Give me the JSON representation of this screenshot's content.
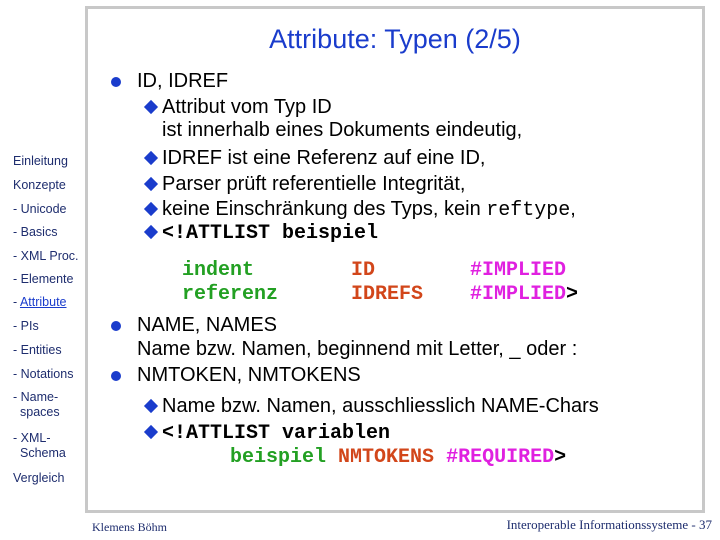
{
  "slide": {
    "title": "Attribute: Typen (2/5)",
    "author": "Klemens Böhm",
    "footer": "Interoperable Informationssysteme - 37"
  },
  "colors": {
    "title": "#1a3ccc",
    "bullet": "#1a3ccc",
    "sidebar_text": "#1e2d6e",
    "code_name": "#23a023",
    "code_type": "#d2461a",
    "code_default": "#e020e0",
    "frame": "#c8c8c8"
  },
  "sidebar": {
    "items": [
      {
        "label": "Einleitung",
        "prefix": ""
      },
      {
        "label": "Konzepte",
        "prefix": ""
      },
      {
        "label": "Unicode",
        "prefix": "- "
      },
      {
        "label": "Basics",
        "prefix": "- "
      },
      {
        "label": "XML Proc.",
        "prefix": "- "
      },
      {
        "label": "Elemente",
        "prefix": "- "
      },
      {
        "label": "Attribute",
        "prefix": "- ",
        "active": true
      },
      {
        "label": "PIs",
        "prefix": "- "
      },
      {
        "label": "Entities",
        "prefix": "- "
      },
      {
        "label": "Notations",
        "prefix": "- "
      },
      {
        "label": "Name-",
        "prefix": "- ",
        "cont": "spaces"
      },
      {
        "label": "XML-",
        "prefix": "- ",
        "cont": "Schema"
      },
      {
        "label": "Vergleich",
        "prefix": ""
      }
    ]
  },
  "content": {
    "b1": {
      "heading": "ID, IDREF",
      "s1_l1": "Attribut vom Typ ID",
      "s1_l2": "ist innerhalb eines Dokuments eindeutig,",
      "s2": "IDREF ist eine Referenz auf eine ID,",
      "s3": "Parser prüft referentielle Integrität,",
      "s4_pre": "keine Einschränkung des Typs, kein ",
      "s4_code": "reftype",
      "s4_post": ",",
      "s5_code": "<!ATTLIST beispiel",
      "attlist_rows": [
        {
          "name": "indent",
          "type": "ID",
          "default": "#IMPLIED",
          "end": ""
        },
        {
          "name": "referenz",
          "type": "IDREFS",
          "default": "#IMPLIED",
          "end": ">"
        }
      ]
    },
    "b2": {
      "heading": "NAME, NAMES",
      "l2": "Name bzw. Namen, beginnend mit Letter, _ oder :"
    },
    "b3": {
      "heading": "NMTOKEN, NMTOKENS",
      "s1": "Name bzw. Namen, ausschliesslich NAME-Chars",
      "s2_code": "<!ATTLIST variablen",
      "row": {
        "name": "beispiel",
        "type": "NMTOKENS",
        "default": "#REQUIRED",
        "end": ">"
      }
    }
  }
}
